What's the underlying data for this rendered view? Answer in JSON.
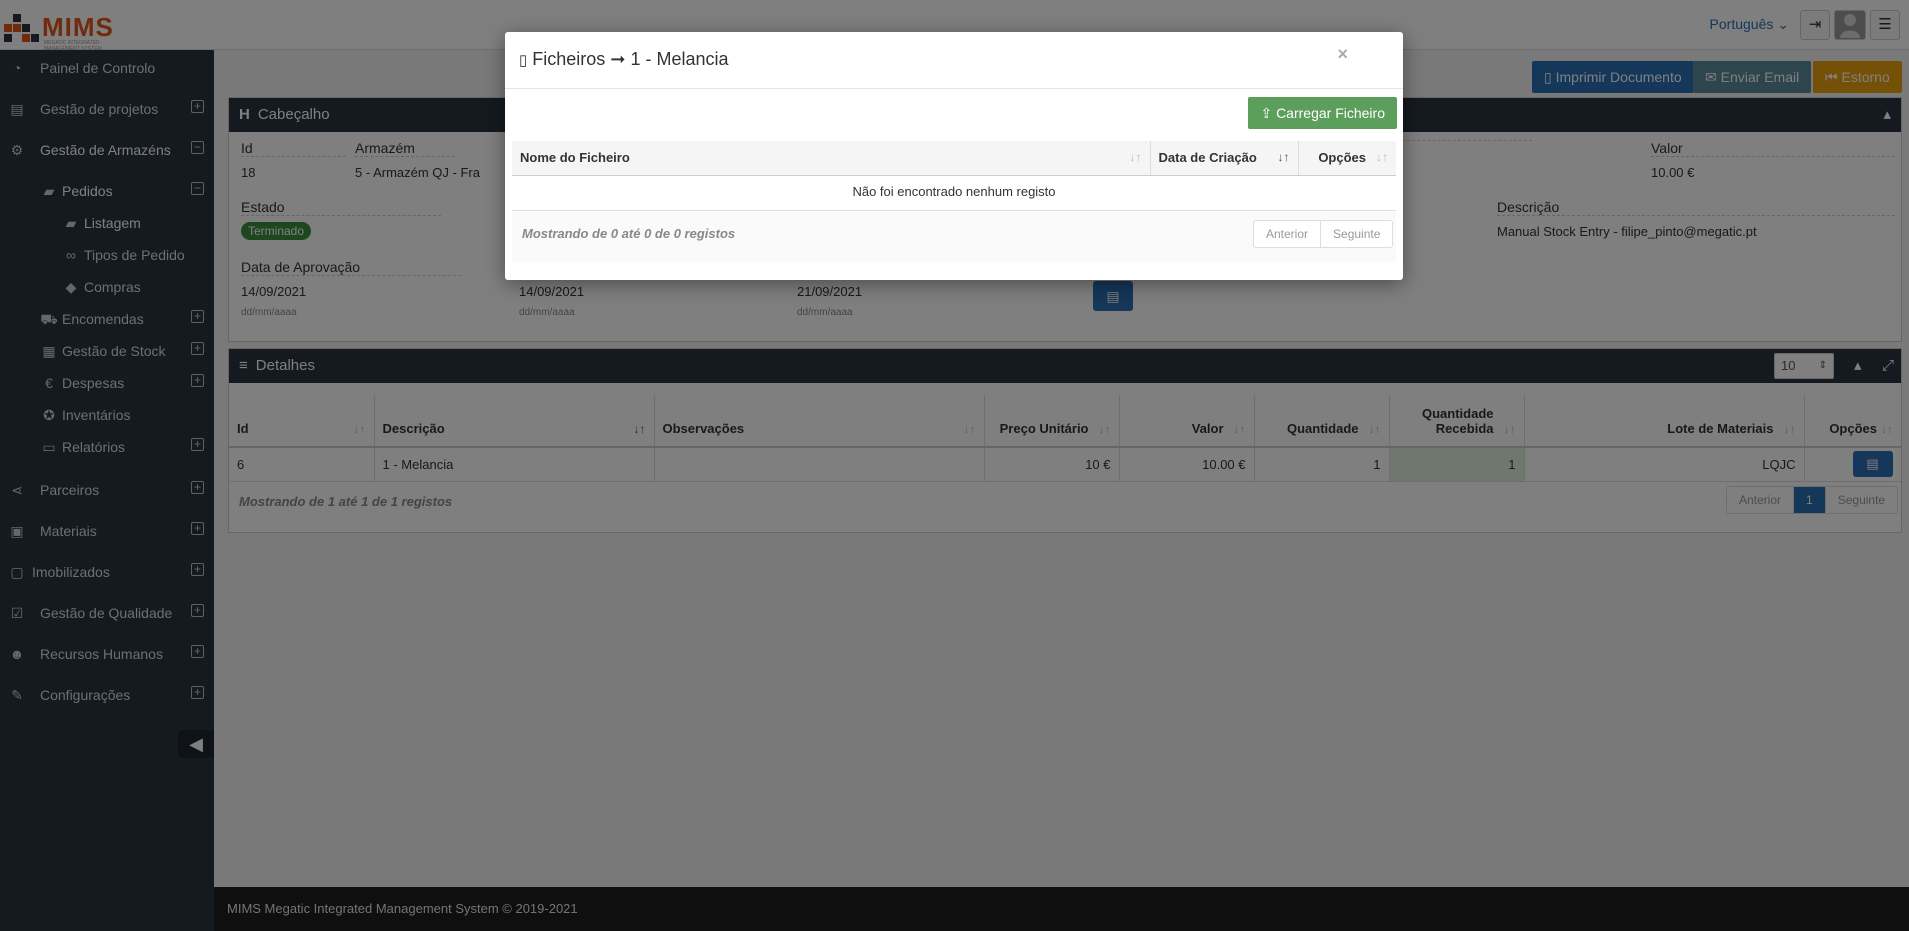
{
  "header": {
    "logo_text": "MIMS",
    "logo_tagline": "MEGATIC INTEGRATED MANAGEMENT SYSTEM",
    "language": "Português"
  },
  "sidebar": {
    "items": [
      {
        "label": "Painel de Controlo",
        "icon": "dashboard-icon"
      },
      {
        "label": "Gestão de projetos",
        "icon": "list-icon",
        "toggle": "+"
      },
      {
        "label": "Gestão de Armazéns",
        "icon": "gears-icon",
        "toggle": "−"
      },
      {
        "label": "Pedidos",
        "icon": "truck-icon",
        "toggle": "−"
      },
      {
        "label": "Listagem",
        "icon": "truck-icon"
      },
      {
        "label": "Tipos de Pedido",
        "icon": "link-icon"
      },
      {
        "label": "Compras",
        "icon": "tag-icon"
      },
      {
        "label": "Encomendas",
        "icon": "cart-icon",
        "toggle": "+"
      },
      {
        "label": "Gestão de Stock",
        "icon": "building-icon",
        "toggle": "+"
      },
      {
        "label": "Despesas",
        "icon": "euro-icon",
        "toggle": "+"
      },
      {
        "label": "Inventários",
        "icon": "medal-icon"
      },
      {
        "label": "Relatórios",
        "icon": "book-icon",
        "toggle": "+"
      },
      {
        "label": "Parceiros",
        "icon": "share-icon",
        "toggle": "+"
      },
      {
        "label": "Materiais",
        "icon": "cubes-icon",
        "toggle": "+"
      },
      {
        "label": "Imobilizados",
        "icon": "lock-icon",
        "toggle": "+"
      },
      {
        "label": "Gestão de Qualidade",
        "icon": "check-icon",
        "toggle": "+"
      },
      {
        "label": "Recursos Humanos",
        "icon": "users-icon",
        "toggle": "+"
      },
      {
        "label": "Configurações",
        "icon": "wrench-icon",
        "toggle": "+"
      }
    ]
  },
  "toolbar": {
    "print_label": "Imprimir Documento",
    "email_label": "Enviar Email",
    "reverse_label": "Estorno"
  },
  "header_panel": {
    "title": "Cabeçalho",
    "fields": {
      "id_label": "Id",
      "id_value": "18",
      "warehouse_label": "Armazém",
      "warehouse_value": "5 - Armazém QJ - Fra",
      "value_label": "Valor",
      "value_value": "10.00 €",
      "state_label": "Estado",
      "state_value": "Terminado",
      "description_label": "Descrição",
      "description_value": "Manual Stock Entry - filipe_pinto@megatic.pt",
      "approval_label": "Data de Aprovação",
      "date1": "14/09/2021",
      "date2": "14/09/2021",
      "date3": "21/09/2021",
      "date_hint": "dd/mm/aaaa"
    }
  },
  "details_panel": {
    "title": "Detalhes",
    "page_size": "10",
    "columns": [
      "Id",
      "Descrição",
      "Observações",
      "Preço Unitário",
      "Valor",
      "Quantidade",
      "Quantidade Recebida",
      "Lote de Materiais",
      "Opções"
    ],
    "rows": [
      {
        "id": "6",
        "descricao": "1 - Melancia",
        "observacoes": "",
        "preco": "10 €",
        "valor": "10.00 €",
        "quantidade": "1",
        "recebida": "1",
        "lote": "LQJC"
      }
    ],
    "info": "Mostrando de 1 até 1 de 1 registos",
    "pager": {
      "prev": "Anterior",
      "page": "1",
      "next": "Seguinte"
    }
  },
  "modal": {
    "title_prefix": "Ficheiros",
    "title_arrow": "➞",
    "title_item": "1 - Melancia",
    "close": "×",
    "upload_label": "Carregar Ficheiro",
    "columns": [
      "Nome do Ficheiro",
      "Data de Criação",
      "Opções"
    ],
    "empty_text": "Não foi encontrado nenhum registo",
    "info": "Mostrando de 0 até 0 de 0 registos",
    "pager": {
      "prev": "Anterior",
      "next": "Seguinte"
    }
  },
  "footer": {
    "text": "MIMS Megatic Integrated Management System © 2019-2021"
  }
}
